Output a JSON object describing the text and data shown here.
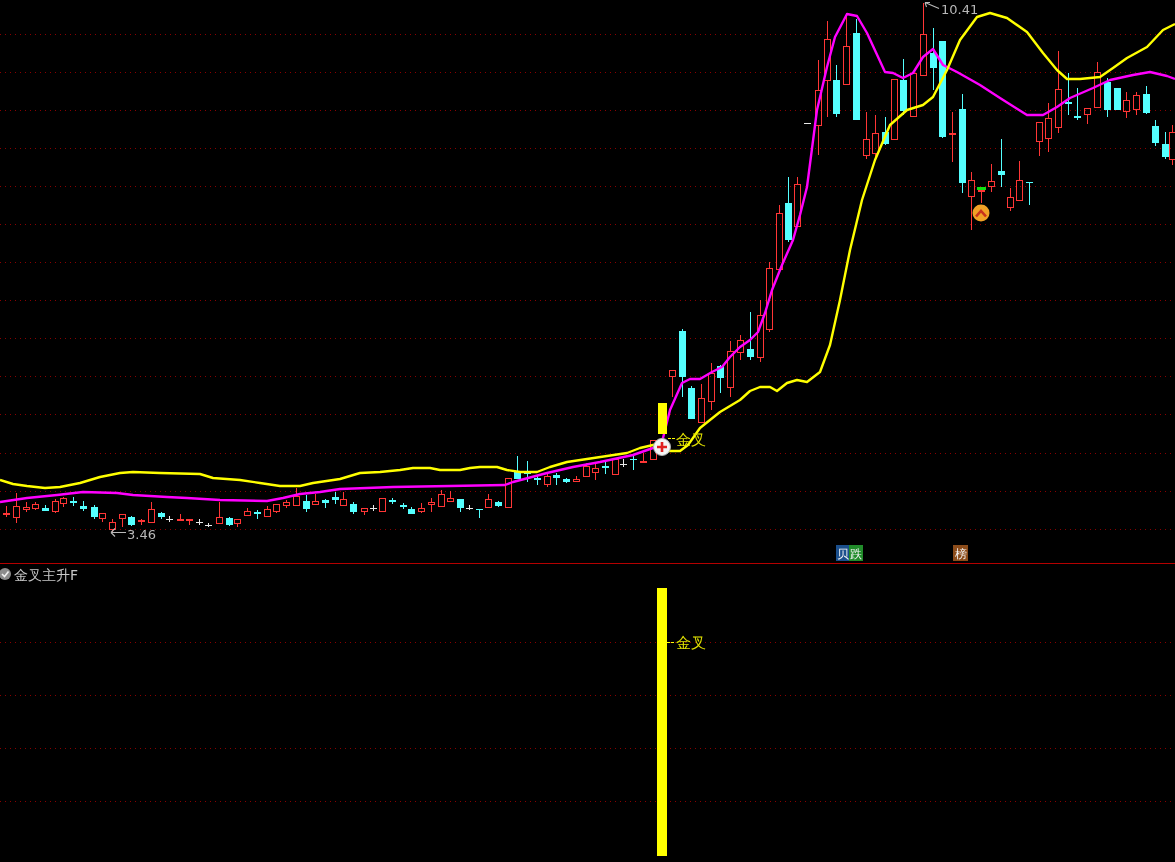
{
  "main_chart": {
    "high_label": "10.41",
    "low_label": "3.46",
    "signal_label": "金叉",
    "event_tags": [
      {
        "text": "贝",
        "color": "#1b4f8c"
      },
      {
        "text": "跌",
        "color": "#218c2a"
      },
      {
        "text": "榜",
        "color": "#8c4c1a"
      }
    ]
  },
  "indicator_panel": {
    "title": "金叉主升F",
    "signal_label": "金叉"
  }
}
